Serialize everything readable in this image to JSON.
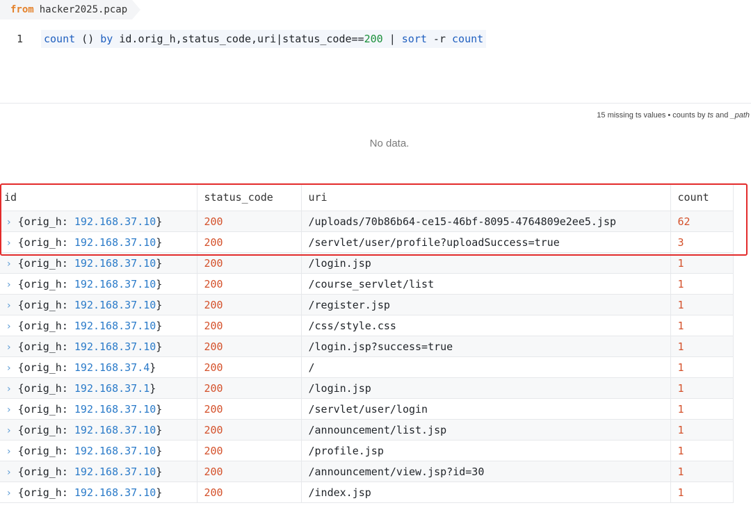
{
  "pool": {
    "keyword": "from",
    "name": "hacker2025.pcap"
  },
  "editor": {
    "line_number": "1",
    "query_parts": [
      "count",
      " () ",
      "by",
      " id.orig_h,status_code,uri|status_code==",
      "200",
      " | ",
      "sort",
      " -r ",
      "count"
    ]
  },
  "meta": {
    "prefix": "15 missing ts values • counts by ",
    "field1": "ts",
    "and": " and ",
    "field2": "_path"
  },
  "empty_message": "No data.",
  "table": {
    "headers": [
      "id",
      "status_code",
      "uri",
      "count"
    ],
    "rows": [
      {
        "id_prefix": "{orig_h: ",
        "ip": "192.168.37.10",
        "id_suffix": "}",
        "status": "200",
        "uri": "/uploads/70b86b64-ce15-46bf-8095-4764809e2ee5.jsp",
        "count": "62"
      },
      {
        "id_prefix": "{orig_h: ",
        "ip": "192.168.37.10",
        "id_suffix": "}",
        "status": "200",
        "uri": "/servlet/user/profile?uploadSuccess=true",
        "count": "3"
      },
      {
        "id_prefix": "{orig_h: ",
        "ip": "192.168.37.10",
        "id_suffix": "}",
        "status": "200",
        "uri": "/login.jsp",
        "count": "1"
      },
      {
        "id_prefix": "{orig_h: ",
        "ip": "192.168.37.10",
        "id_suffix": "}",
        "status": "200",
        "uri": "/course_servlet/list",
        "count": "1"
      },
      {
        "id_prefix": "{orig_h: ",
        "ip": "192.168.37.10",
        "id_suffix": "}",
        "status": "200",
        "uri": "/register.jsp",
        "count": "1"
      },
      {
        "id_prefix": "{orig_h: ",
        "ip": "192.168.37.10",
        "id_suffix": "}",
        "status": "200",
        "uri": "/css/style.css",
        "count": "1"
      },
      {
        "id_prefix": "{orig_h: ",
        "ip": "192.168.37.10",
        "id_suffix": "}",
        "status": "200",
        "uri": "/login.jsp?success=true",
        "count": "1"
      },
      {
        "id_prefix": "{orig_h: ",
        "ip": "192.168.37.4",
        "id_suffix": "}",
        "status": "200",
        "uri": "/",
        "count": "1"
      },
      {
        "id_prefix": "{orig_h: ",
        "ip": "192.168.37.1",
        "id_suffix": "}",
        "status": "200",
        "uri": "/login.jsp",
        "count": "1"
      },
      {
        "id_prefix": "{orig_h: ",
        "ip": "192.168.37.10",
        "id_suffix": "}",
        "status": "200",
        "uri": "/servlet/user/login",
        "count": "1"
      },
      {
        "id_prefix": "{orig_h: ",
        "ip": "192.168.37.10",
        "id_suffix": "}",
        "status": "200",
        "uri": "/announcement/list.jsp",
        "count": "1"
      },
      {
        "id_prefix": "{orig_h: ",
        "ip": "192.168.37.10",
        "id_suffix": "}",
        "status": "200",
        "uri": "/profile.jsp",
        "count": "1"
      },
      {
        "id_prefix": "{orig_h: ",
        "ip": "192.168.37.10",
        "id_suffix": "}",
        "status": "200",
        "uri": "/announcement/view.jsp?id=30",
        "count": "1"
      },
      {
        "id_prefix": "{orig_h: ",
        "ip": "192.168.37.10",
        "id_suffix": "}",
        "status": "200",
        "uri": "/index.jsp",
        "count": "1"
      }
    ]
  },
  "colors": {
    "highlight_border": "#e32b2b",
    "keyword": "#e4822c",
    "ip": "#2b7bc9",
    "value": "#d4512b"
  },
  "icons": {
    "expand": "chevron-right-icon"
  }
}
